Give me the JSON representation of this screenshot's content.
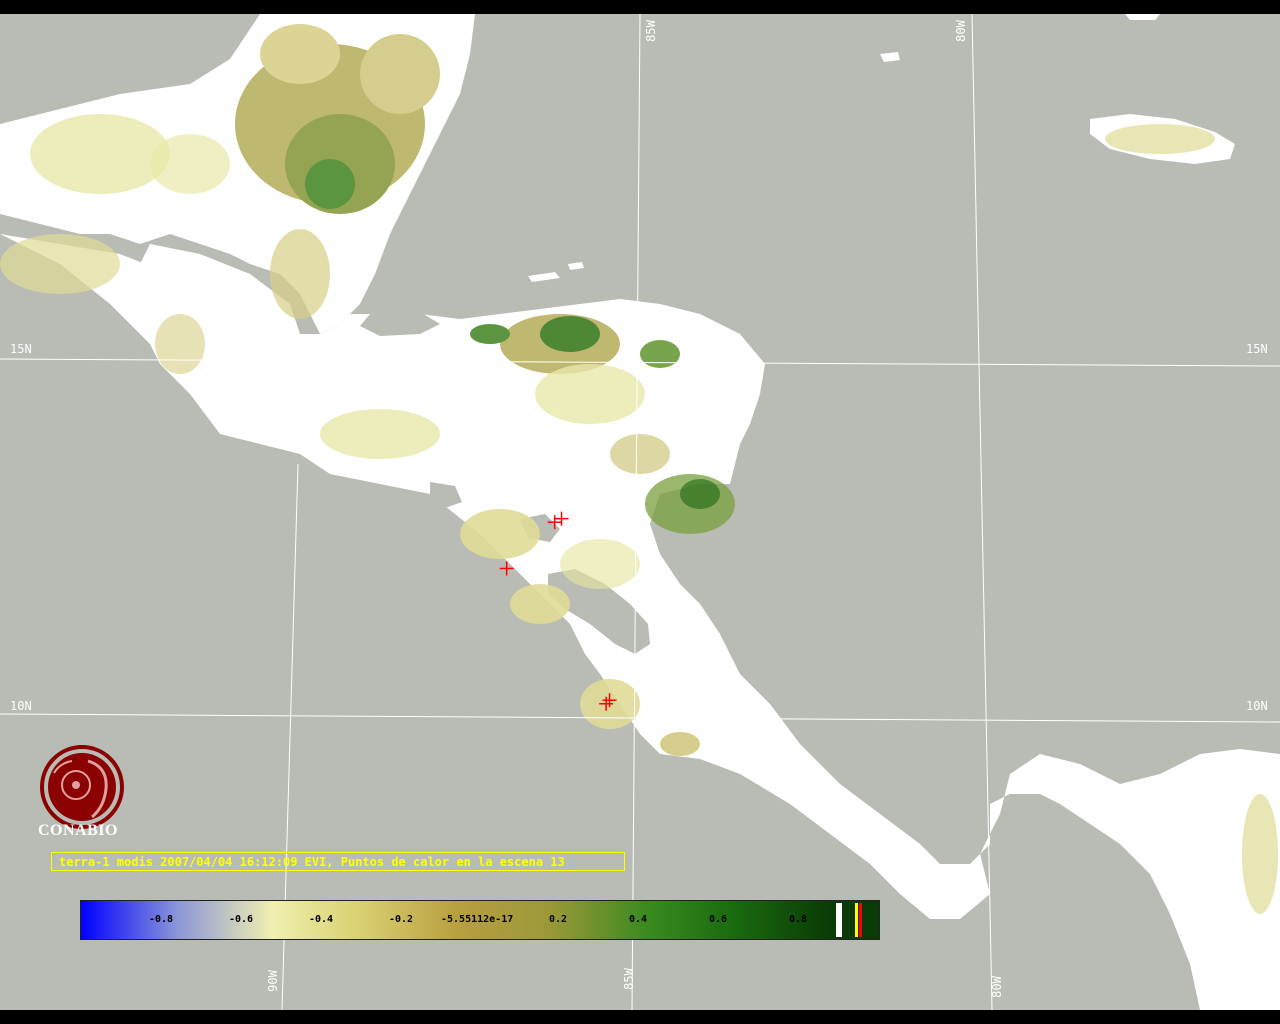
{
  "grid_labels": {
    "lon_top_85": "85W",
    "lon_top_80": "80W",
    "lat_15_left": "15N",
    "lat_15_right": "15N",
    "lat_10_left": "10N",
    "lat_10_right": "10N",
    "lon_bottom_90": "90W",
    "lon_bottom_85": "85W",
    "lon_bottom_80": "80W"
  },
  "caption": "terra-1 modis 2007/04/04 16:12:09 EVI, Puntos de calor en la escena 13",
  "logo": {
    "text": "CONABIO"
  },
  "colorbar": {
    "ticks": [
      "-0.8",
      "-0.6",
      "-0.4",
      "-0.2",
      "-5.55112e-17",
      "0.2",
      "0.4",
      "0.6",
      "0.8"
    ],
    "stops": [
      "#0000ff",
      "#8a95d8",
      "#f0f0b0",
      "#d8d070",
      "#b8a040",
      "#9a9838",
      "#3a8a20",
      "#1a6a10",
      "#0a3a05"
    ]
  },
  "colors": {
    "ocean": "#b8bcb4",
    "cloud_land": "#ffffff",
    "vegetation_light": "#e6e6a0",
    "vegetation_mid": "#b8b060",
    "vegetation_dense": "#4a8a2a",
    "hotspot": "#ff0000",
    "caption": "#ffff00",
    "logo": "#8b0000"
  },
  "hotspots": [
    {
      "lon": -86.2,
      "lat": 12.75
    },
    {
      "lon": -86.1,
      "lat": 12.8
    },
    {
      "lon": -86.9,
      "lat": 12.1
    },
    {
      "lon": -85.45,
      "lat": 10.2
    },
    {
      "lon": -85.4,
      "lat": 10.25
    }
  ]
}
